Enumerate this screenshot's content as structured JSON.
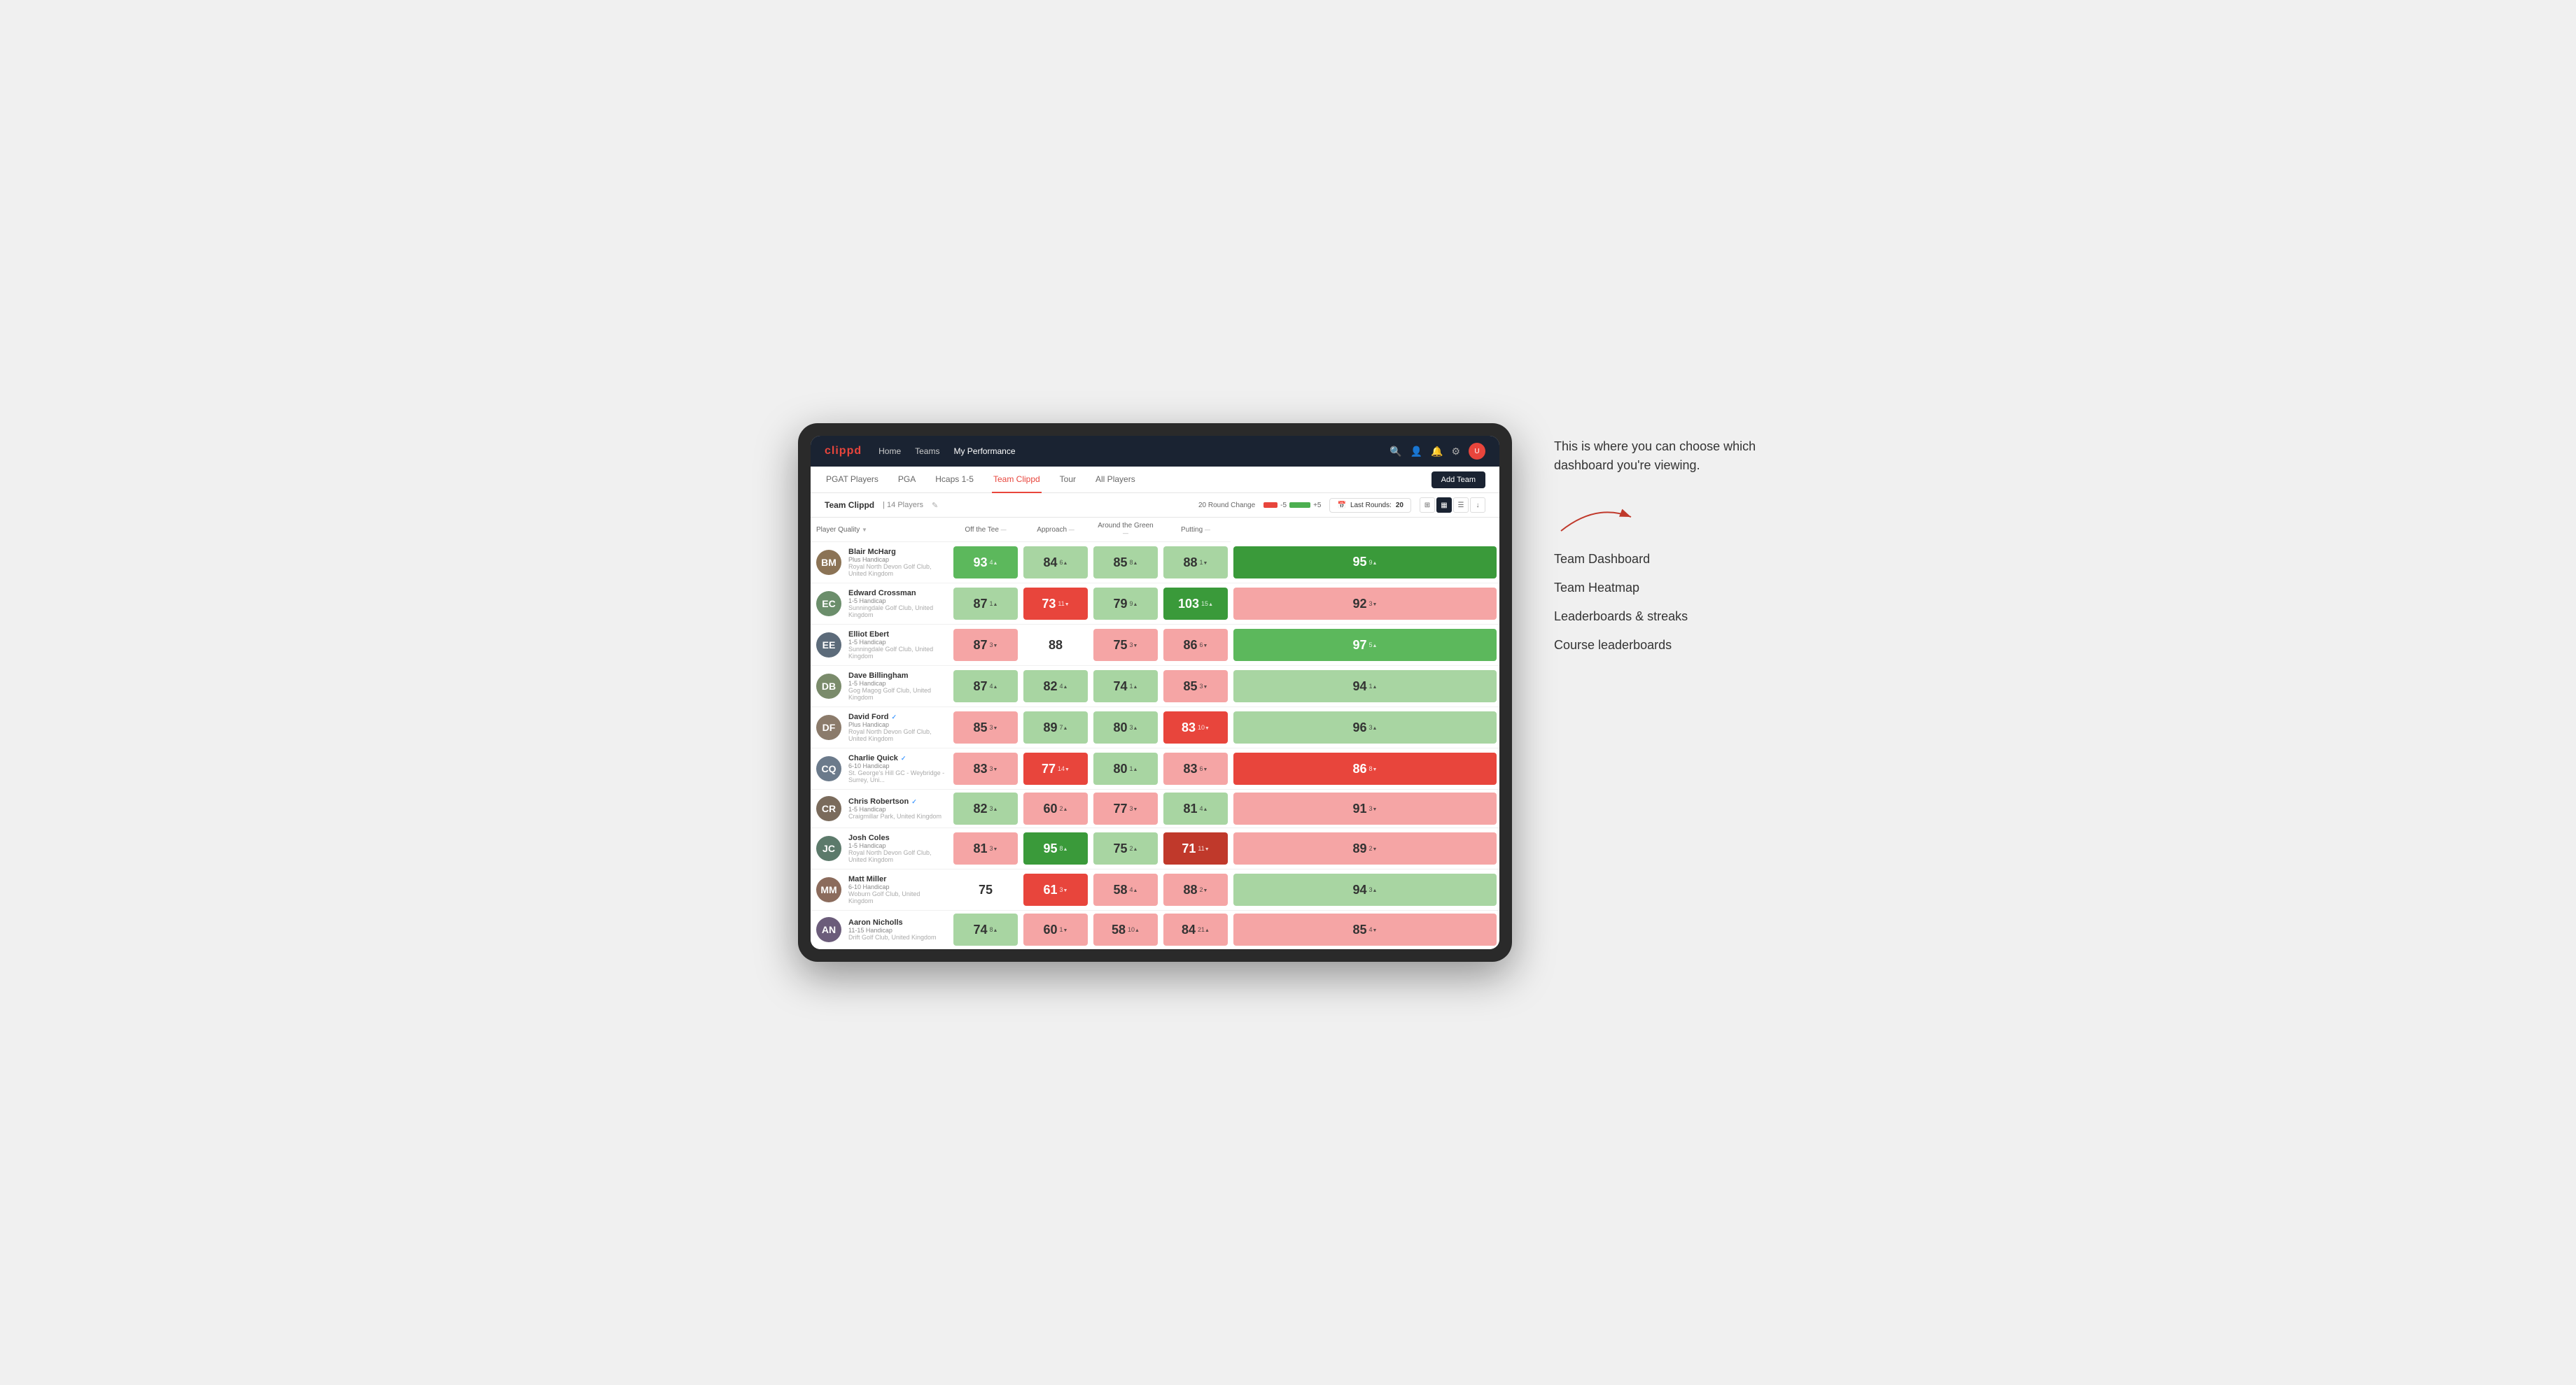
{
  "annotation": {
    "callout": "This is where you can choose which dashboard you're viewing.",
    "arrow": "→",
    "items": [
      "Team Dashboard",
      "Team Heatmap",
      "Leaderboards & streaks",
      "Course leaderboards"
    ]
  },
  "nav": {
    "logo": "clippd",
    "links": [
      "Home",
      "Teams",
      "My Performance"
    ],
    "active_link": "My Performance",
    "icons": [
      "🔍",
      "👤",
      "🔔",
      "⚙"
    ]
  },
  "sub_nav": {
    "links": [
      "PGAT Players",
      "PGA",
      "Hcaps 1-5",
      "Team Clippd",
      "Tour",
      "All Players"
    ],
    "active_link": "Team Clippd",
    "add_team_label": "Add Team"
  },
  "team_header": {
    "title": "Team Clippd",
    "separator": "|",
    "count_label": "14 Players",
    "round_change_label": "20 Round Change",
    "neg_label": "-5",
    "pos_label": "+5",
    "last_rounds_label": "Last Rounds:",
    "last_rounds_value": "20"
  },
  "table": {
    "columns": [
      {
        "label": "Player Quality",
        "key": "quality",
        "sortable": true
      },
      {
        "label": "Off the Tee",
        "key": "tee",
        "sortable": true
      },
      {
        "label": "Approach",
        "key": "approach",
        "sortable": true
      },
      {
        "label": "Around the Green",
        "key": "green",
        "sortable": true
      },
      {
        "label": "Putting",
        "key": "putting",
        "sortable": true
      }
    ],
    "rows": [
      {
        "name": "Blair McHarg",
        "hcap": "Plus Handicap",
        "club": "Royal North Devon Golf Club, United Kingdom",
        "verified": false,
        "avatar_color": "#8B7355",
        "quality": {
          "value": 93,
          "change": 4,
          "dir": "up",
          "color": "green-med"
        },
        "tee": {
          "value": 84,
          "change": 6,
          "dir": "up",
          "color": "green-light"
        },
        "approach": {
          "value": 85,
          "change": 8,
          "dir": "up",
          "color": "green-light"
        },
        "green": {
          "value": 88,
          "change": 1,
          "dir": "down",
          "color": "green-light"
        },
        "putting": {
          "value": 95,
          "change": 9,
          "dir": "up",
          "color": "green-dark"
        }
      },
      {
        "name": "Edward Crossman",
        "hcap": "1-5 Handicap",
        "club": "Sunningdale Golf Club, United Kingdom",
        "verified": false,
        "avatar_color": "#6B8E6B",
        "quality": {
          "value": 87,
          "change": 1,
          "dir": "up",
          "color": "green-light"
        },
        "tee": {
          "value": 73,
          "change": 11,
          "dir": "down",
          "color": "red-med"
        },
        "approach": {
          "value": 79,
          "change": 9,
          "dir": "up",
          "color": "green-light"
        },
        "green": {
          "value": 103,
          "change": 15,
          "dir": "up",
          "color": "green-dark"
        },
        "putting": {
          "value": 92,
          "change": 3,
          "dir": "down",
          "color": "red-light"
        }
      },
      {
        "name": "Elliot Ebert",
        "hcap": "1-5 Handicap",
        "club": "Sunningdale Golf Club, United Kingdom",
        "verified": false,
        "avatar_color": "#5C6B7A",
        "quality": {
          "value": 87,
          "change": 3,
          "dir": "down",
          "color": "red-light"
        },
        "tee": {
          "value": 88,
          "change": 0,
          "dir": "neutral",
          "color": "white"
        },
        "approach": {
          "value": 75,
          "change": 3,
          "dir": "down",
          "color": "red-light"
        },
        "green": {
          "value": 86,
          "change": 6,
          "dir": "down",
          "color": "red-light"
        },
        "putting": {
          "value": 97,
          "change": 5,
          "dir": "up",
          "color": "green-med"
        }
      },
      {
        "name": "Dave Billingham",
        "hcap": "1-5 Handicap",
        "club": "Gog Magog Golf Club, United Kingdom",
        "verified": false,
        "avatar_color": "#7A8B6B",
        "quality": {
          "value": 87,
          "change": 4,
          "dir": "up",
          "color": "green-light"
        },
        "tee": {
          "value": 82,
          "change": 4,
          "dir": "up",
          "color": "green-light"
        },
        "approach": {
          "value": 74,
          "change": 1,
          "dir": "up",
          "color": "green-light"
        },
        "green": {
          "value": 85,
          "change": 3,
          "dir": "down",
          "color": "red-light"
        },
        "putting": {
          "value": 94,
          "change": 1,
          "dir": "up",
          "color": "green-light"
        }
      },
      {
        "name": "David Ford",
        "hcap": "Plus Handicap",
        "club": "Royal North Devon Golf Club, United Kingdom",
        "verified": true,
        "avatar_color": "#8B7B6B",
        "quality": {
          "value": 85,
          "change": 3,
          "dir": "down",
          "color": "red-light"
        },
        "tee": {
          "value": 89,
          "change": 7,
          "dir": "up",
          "color": "green-light"
        },
        "approach": {
          "value": 80,
          "change": 3,
          "dir": "up",
          "color": "green-light"
        },
        "green": {
          "value": 83,
          "change": 10,
          "dir": "down",
          "color": "red-med"
        },
        "putting": {
          "value": 96,
          "change": 3,
          "dir": "up",
          "color": "green-light"
        }
      },
      {
        "name": "Charlie Quick",
        "hcap": "6-10 Handicap",
        "club": "St. George's Hill GC - Weybridge - Surrey, Uni...",
        "verified": true,
        "avatar_color": "#6B7A8B",
        "quality": {
          "value": 83,
          "change": 3,
          "dir": "down",
          "color": "red-light"
        },
        "tee": {
          "value": 77,
          "change": 14,
          "dir": "down",
          "color": "red-med"
        },
        "approach": {
          "value": 80,
          "change": 1,
          "dir": "up",
          "color": "green-light"
        },
        "green": {
          "value": 83,
          "change": 6,
          "dir": "down",
          "color": "red-light"
        },
        "putting": {
          "value": 86,
          "change": 8,
          "dir": "down",
          "color": "red-med"
        }
      },
      {
        "name": "Chris Robertson",
        "hcap": "1-5 Handicap",
        "club": "Craigmillar Park, United Kingdom",
        "verified": true,
        "avatar_color": "#7A6B5C",
        "quality": {
          "value": 82,
          "change": 3,
          "dir": "up",
          "color": "green-light"
        },
        "tee": {
          "value": 60,
          "change": 2,
          "dir": "up",
          "color": "red-light"
        },
        "approach": {
          "value": 77,
          "change": 3,
          "dir": "down",
          "color": "red-light"
        },
        "green": {
          "value": 81,
          "change": 4,
          "dir": "up",
          "color": "green-light"
        },
        "putting": {
          "value": 91,
          "change": 3,
          "dir": "down",
          "color": "red-light"
        }
      },
      {
        "name": "Josh Coles",
        "hcap": "1-5 Handicap",
        "club": "Royal North Devon Golf Club, United Kingdom",
        "verified": false,
        "avatar_color": "#5C7A6B",
        "quality": {
          "value": 81,
          "change": 3,
          "dir": "down",
          "color": "red-light"
        },
        "tee": {
          "value": 95,
          "change": 8,
          "dir": "up",
          "color": "green-dark"
        },
        "approach": {
          "value": 75,
          "change": 2,
          "dir": "up",
          "color": "green-light"
        },
        "green": {
          "value": 71,
          "change": 11,
          "dir": "down",
          "color": "red-dark"
        },
        "putting": {
          "value": 89,
          "change": 2,
          "dir": "down",
          "color": "red-light"
        }
      },
      {
        "name": "Matt Miller",
        "hcap": "6-10 Handicap",
        "club": "Woburn Golf Club, United Kingdom",
        "verified": false,
        "avatar_color": "#8B6B5C",
        "quality": {
          "value": 75,
          "change": 0,
          "dir": "neutral",
          "color": "white"
        },
        "tee": {
          "value": 61,
          "change": 3,
          "dir": "down",
          "color": "red-med"
        },
        "approach": {
          "value": 58,
          "change": 4,
          "dir": "up",
          "color": "red-light"
        },
        "green": {
          "value": 88,
          "change": 2,
          "dir": "down",
          "color": "red-light"
        },
        "putting": {
          "value": 94,
          "change": 3,
          "dir": "up",
          "color": "green-light"
        }
      },
      {
        "name": "Aaron Nicholls",
        "hcap": "11-15 Handicap",
        "club": "Drift Golf Club, United Kingdom",
        "verified": false,
        "avatar_color": "#6B5C7A",
        "quality": {
          "value": 74,
          "change": 8,
          "dir": "up",
          "color": "green-light"
        },
        "tee": {
          "value": 60,
          "change": 1,
          "dir": "down",
          "color": "red-light"
        },
        "approach": {
          "value": 58,
          "change": 10,
          "dir": "up",
          "color": "red-light"
        },
        "green": {
          "value": 84,
          "change": 21,
          "dir": "up",
          "color": "red-light"
        },
        "putting": {
          "value": 85,
          "change": 4,
          "dir": "down",
          "color": "red-light"
        }
      }
    ]
  }
}
